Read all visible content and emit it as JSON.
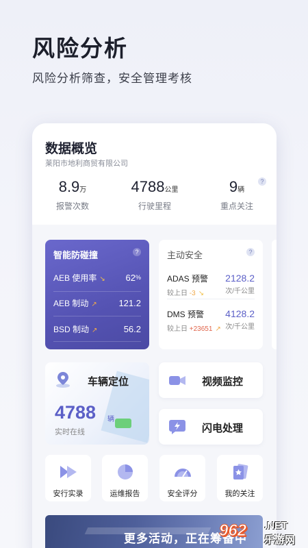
{
  "hero": {
    "title": "风险分析",
    "subtitle": "风险分析筛查，安全管理考核"
  },
  "overview": {
    "title": "数据概览",
    "company": "莱阳市地利商贸有限公司",
    "help": "?",
    "stats": [
      {
        "value": "8.9",
        "unit": "万",
        "label": "报警次数"
      },
      {
        "value": "4788",
        "unit": "公里",
        "label": "行驶里程"
      },
      {
        "value": "9",
        "unit": "辆",
        "label": "重点关注"
      }
    ]
  },
  "anti_collision": {
    "title": "智能防碰撞",
    "help": "?",
    "rows": [
      {
        "name": "AEB 使用率",
        "trend": "down",
        "value": "62",
        "unit": "%"
      },
      {
        "name": "AEB 制动",
        "trend": "up",
        "value": "121.2",
        "unit": ""
      },
      {
        "name": "BSD 制动",
        "trend": "up",
        "value": "56.2",
        "unit": ""
      }
    ]
  },
  "active_safety": {
    "title": "主动安全",
    "help": "?",
    "items": [
      {
        "name": "ADAS 预警",
        "compare_label": "较上日",
        "compare_value": "-3",
        "trend": "down",
        "value": "2128.2",
        "unit": "次/千公里"
      },
      {
        "name": "DMS 预警",
        "compare_label": "较上日",
        "compare_value": "+23651",
        "trend": "up",
        "value": "4128.2",
        "unit": "次/千公里"
      }
    ]
  },
  "vehicle_location": {
    "title": "车辆定位",
    "value": "4788",
    "unit": "辆",
    "subtitle": "实时在线"
  },
  "tiles": [
    {
      "label": "视频监控",
      "icon": "video-camera-icon"
    },
    {
      "label": "闪电处理",
      "icon": "lightning-chat-icon"
    }
  ],
  "quick_actions": [
    {
      "label": "安行实录",
      "icon": "fast-forward-icon"
    },
    {
      "label": "运维报告",
      "icon": "pie-chart-icon"
    },
    {
      "label": "安全评分",
      "icon": "gauge-icon"
    },
    {
      "label": "我的关注",
      "icon": "favorite-card-icon"
    }
  ],
  "banner": {
    "text": "更多活动，正在筹备中"
  },
  "watermark": {
    "left": "962",
    "right_top": ".NET",
    "right_bottom": "乐游网"
  },
  "colors": {
    "accent": "#5b5fc7",
    "purple_card": "#5553b3",
    "trend_up": "#f0a94a",
    "online_green": "#6ccf7a"
  }
}
